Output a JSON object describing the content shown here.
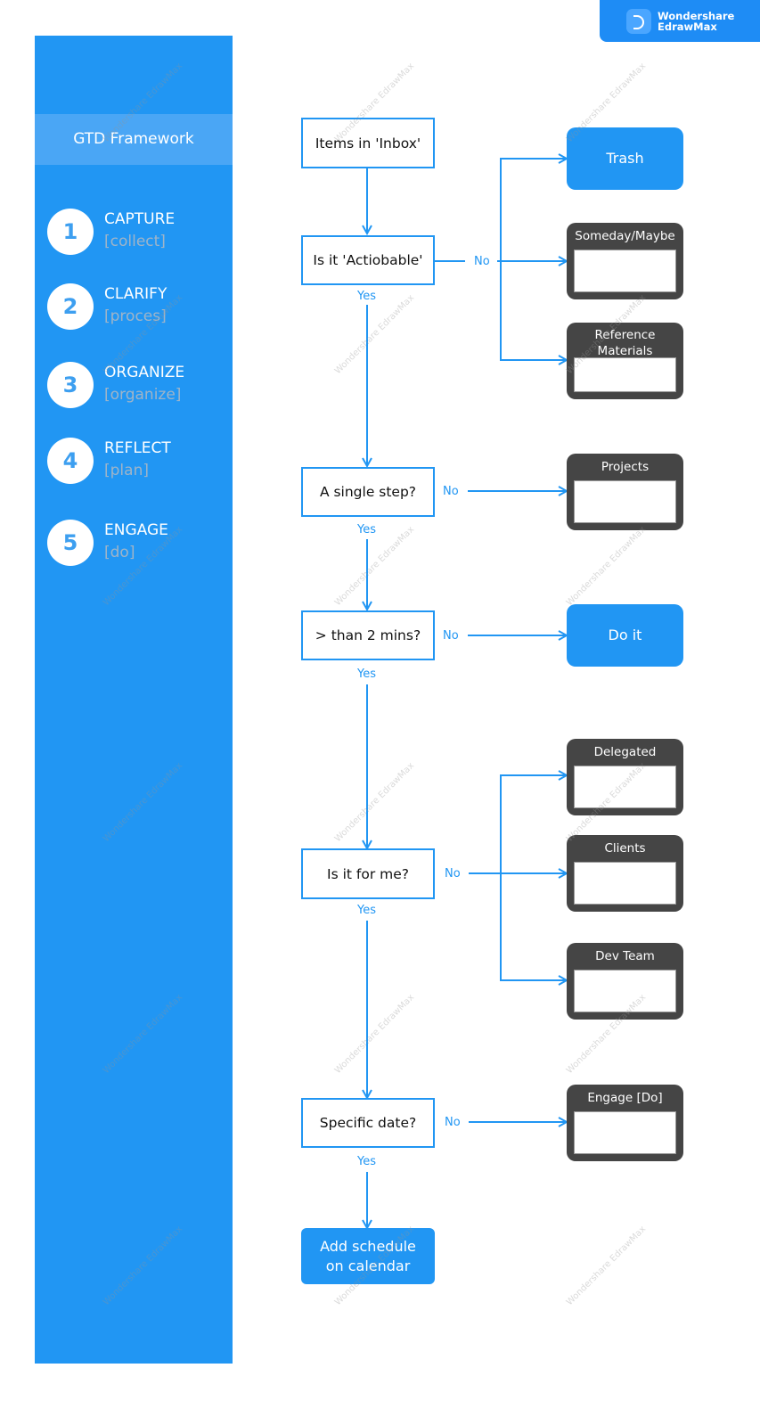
{
  "brand": {
    "line1": "Wondershare",
    "line2": "EdrawMax",
    "color": "#1e8cf5"
  },
  "sidebar": {
    "title": "GTD Framework",
    "steps": [
      {
        "num": "1",
        "name": "CAPTURE",
        "sub": "[collect]"
      },
      {
        "num": "2",
        "name": "CLARIFY",
        "sub": "[proces]"
      },
      {
        "num": "3",
        "name": "ORGANIZE",
        "sub": "[organize]"
      },
      {
        "num": "4",
        "name": "REFLECT",
        "sub": "[plan]"
      },
      {
        "num": "5",
        "name": "ENGAGE",
        "sub": "[do]"
      }
    ]
  },
  "flow": {
    "decisions": {
      "inbox": "Items in 'Inbox'",
      "actionable": "Is it 'Actiobable'",
      "single": "A single step?",
      "twomin": "> than 2 mins?",
      "forme": "Is it for me?",
      "date": "Specific date?"
    },
    "outcomes": {
      "trash": "Trash",
      "someday": "Someday/Maybe",
      "reference": "Reference Materials",
      "projects": "Projects",
      "doit": "Do it",
      "delegated": "Delegated",
      "clients": "Clients",
      "devteam": "Dev Team",
      "engage": "Engage [Do]",
      "schedule": "Add schedule on calendar"
    },
    "labels": {
      "yes": "Yes",
      "no": "No"
    }
  },
  "watermark": "Wondershare EdrawMax",
  "colors": {
    "accent": "#2196f3",
    "dark": "#454545",
    "sidebar_sub": "#9fb4c8"
  }
}
